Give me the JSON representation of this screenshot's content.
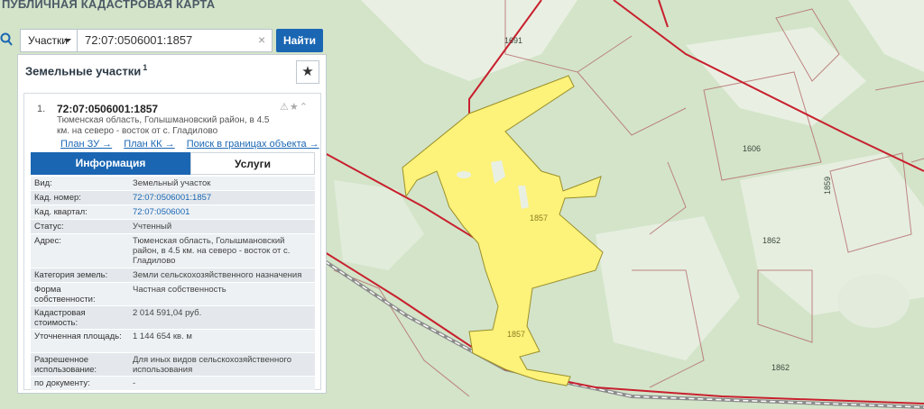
{
  "app": {
    "title": "ПУБЛИЧНАЯ КАДАСТРОВАЯ КАРТА"
  },
  "search": {
    "type_label": "Участки",
    "value": "72:07:0506001:1857",
    "button_label": "Найти"
  },
  "panel": {
    "title": "Земельные участки",
    "count": "1",
    "item": {
      "number": "1.",
      "cad_number": "72:07:0506001:1857",
      "address": "Тюменская область, Голышмановский район, в 4.5 км. на северо - восток от с. Гладилово",
      "links": [
        "План ЗУ →",
        "План КК →",
        "Поиск в границах объекта →"
      ]
    },
    "tabs": [
      "Информация",
      "Услуги"
    ],
    "properties": [
      {
        "label": "Вид:",
        "value": "Земельный участок",
        "link": false
      },
      {
        "label": "Кад. номер:",
        "value": "72:07:0506001:1857",
        "link": true
      },
      {
        "label": "Кад. квартал:",
        "value": "72:07:0506001",
        "link": true
      },
      {
        "label": "Статус:",
        "value": "Учтенный",
        "link": false
      },
      {
        "label": "Адрес:",
        "value": "Тюменская область, Голышмановский район, в 4.5 км. на северо - восток от с. Гладилово",
        "link": false
      },
      {
        "label": "Категория земель:",
        "value": "Земли сельскохозяйственного назначения",
        "link": false
      },
      {
        "label": "Форма собственности:",
        "value": "Частная собственность",
        "link": false
      },
      {
        "label": "Кадастровая стоимость:",
        "value": "2 014 591,04 руб.",
        "link": false
      },
      {
        "label": "Уточненная площадь:",
        "value": "1 144 654 кв. м",
        "link": false
      },
      {
        "label": "Разрешенное использование:",
        "value": "Для иных видов сельскохозяйственного использования",
        "link": false
      },
      {
        "label": "по документу:",
        "value": "-",
        "link": false
      }
    ]
  },
  "map": {
    "parcel_labels": [
      "1691",
      "1606",
      "1859",
      "1862",
      "1857",
      "1857",
      "1862"
    ],
    "colors": {
      "forest": "#c9dfc0",
      "field": "#eef3e9",
      "parcel": "#fdf27a",
      "boundary": "#c8202e"
    }
  }
}
